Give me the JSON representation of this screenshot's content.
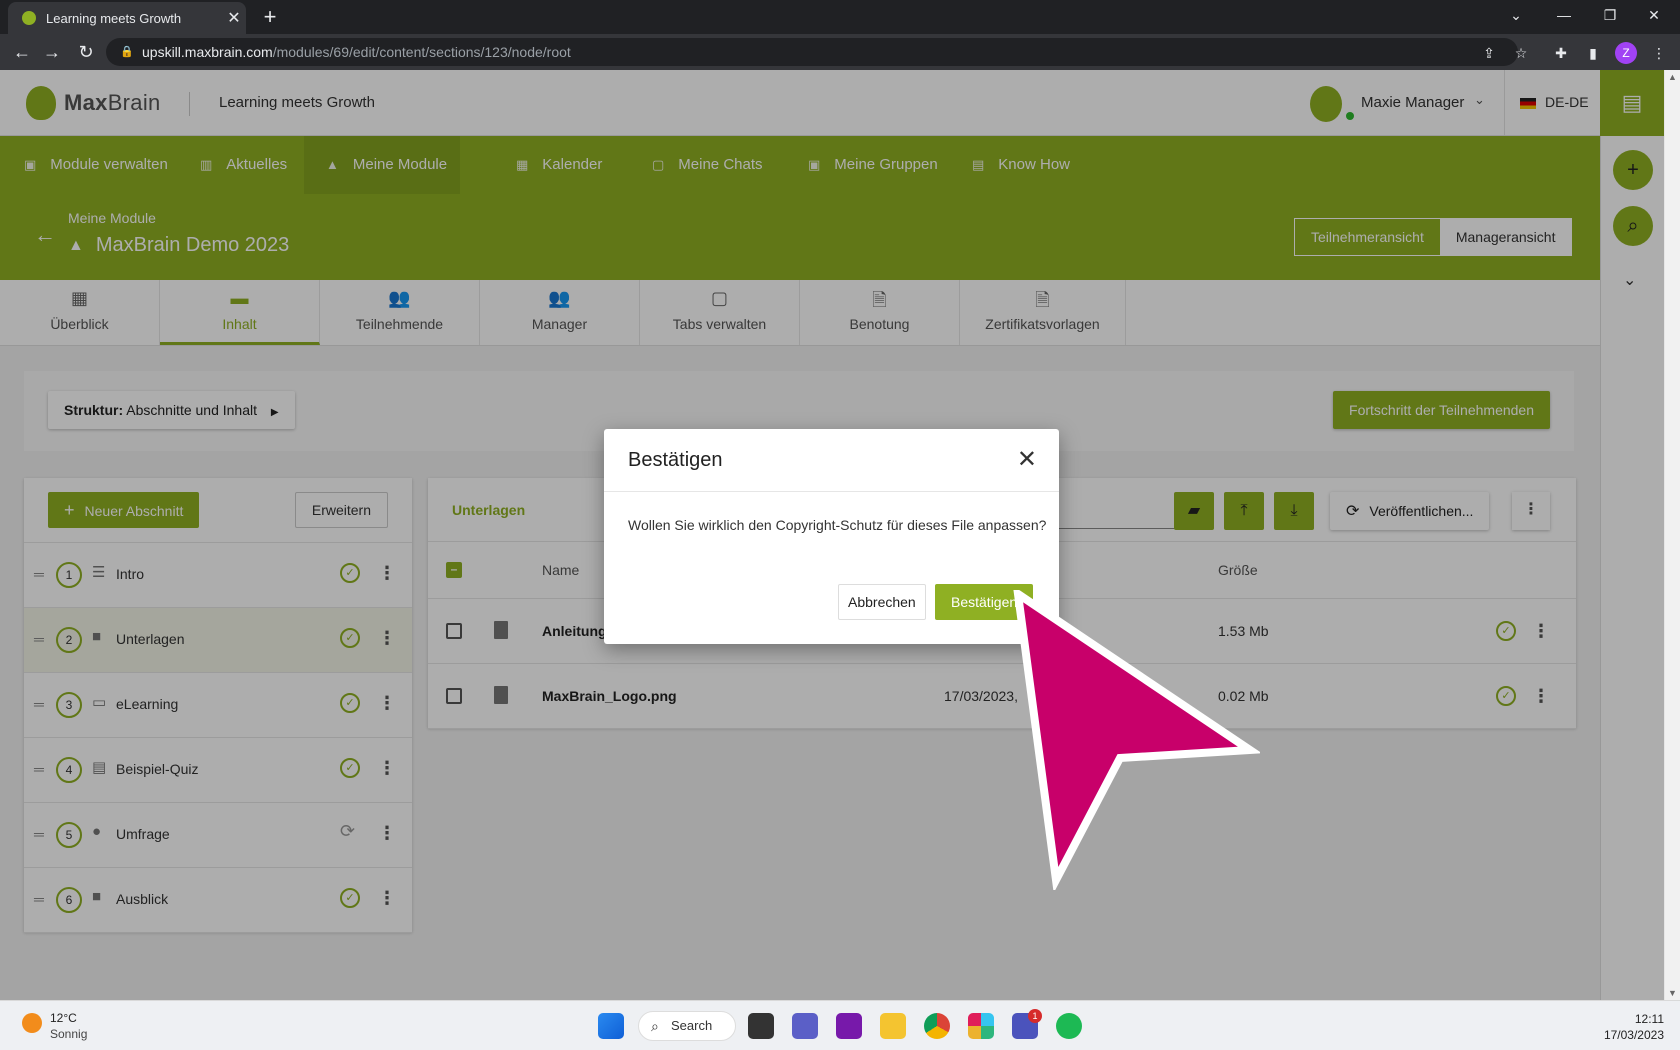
{
  "browser": {
    "tab_title": "Learning meets Growth",
    "url_host": "upskill.maxbrain.com",
    "url_path": "/modules/69/edit/content/sections/123/node/root",
    "profile_initial": "Z"
  },
  "header": {
    "logo_bold": "Max",
    "logo_rest": "Brain",
    "tagline": "Learning meets Growth",
    "user_name": "Maxie Manager",
    "language": "DE-DE"
  },
  "nav": {
    "items": [
      {
        "label": "Module verwalten",
        "icon": "folder-icon"
      },
      {
        "label": "Aktuelles",
        "icon": "news-icon"
      },
      {
        "label": "Meine Module",
        "icon": "graduation-cap-icon"
      },
      {
        "label": "Kalender",
        "icon": "calendar-icon"
      },
      {
        "label": "Meine Chats",
        "icon": "chat-icon"
      },
      {
        "label": "Meine Gruppen",
        "icon": "groups-icon"
      },
      {
        "label": "Know How",
        "icon": "book-icon"
      }
    ]
  },
  "module": {
    "breadcrumb": "Meine Module",
    "title": "MaxBrain Demo 2023",
    "view_participant": "Teilnehmeransicht",
    "view_manager": "Manageransicht"
  },
  "tabs": [
    {
      "label": "Überblick",
      "glyph": "▦"
    },
    {
      "label": "Inhalt",
      "glyph": "▬"
    },
    {
      "label": "Teilnehmende",
      "glyph": "👥"
    },
    {
      "label": "Manager",
      "glyph": "👥"
    },
    {
      "label": "Tabs verwalten",
      "glyph": "▢"
    },
    {
      "label": "Benotung",
      "glyph": "🗎"
    },
    {
      "label": "Zertifikatsvorlagen",
      "glyph": "🗎"
    }
  ],
  "structure": {
    "label_bold": "Struktur:",
    "label_rest": "Abschnitte und Inhalt",
    "progress_button": "Fortschritt der Teilnehmenden"
  },
  "sections": {
    "new_button": "Neuer Abschnitt",
    "expand_button": "Erweitern",
    "items": [
      {
        "num": "1",
        "name": "Intro",
        "status": "published"
      },
      {
        "num": "2",
        "name": "Unterlagen",
        "status": "published"
      },
      {
        "num": "3",
        "name": "eLearning",
        "status": "published"
      },
      {
        "num": "4",
        "name": "Beispiel-Quiz",
        "status": "published"
      },
      {
        "num": "5",
        "name": "Umfrage",
        "status": "syncing"
      },
      {
        "num": "6",
        "name": "Ausblick",
        "status": "published"
      }
    ]
  },
  "files": {
    "title": "Unterlagen",
    "publish_button": "Veröffentlichen...",
    "col_name": "Name",
    "col_size": "Größe",
    "rows": [
      {
        "name": "Anleitung_",
        "date": "",
        "size": "1.53 Mb"
      },
      {
        "name": "MaxBrain_Logo.png",
        "date": "17/03/2023,",
        "size": "0.02 Mb"
      }
    ]
  },
  "dialog": {
    "title": "Bestätigen",
    "message": "Wollen Sie wirklich den Copyright-Schutz für dieses File anpassen?",
    "cancel": "Abbrechen",
    "confirm": "Bestätigen"
  },
  "taskbar": {
    "temperature": "12°C",
    "weather": "Sonnig",
    "search": "Search",
    "badge": "1",
    "time": "12:11",
    "date": "17/03/2023"
  },
  "colors": {
    "brand": "#8fb023",
    "cursor": "#c8006a"
  }
}
